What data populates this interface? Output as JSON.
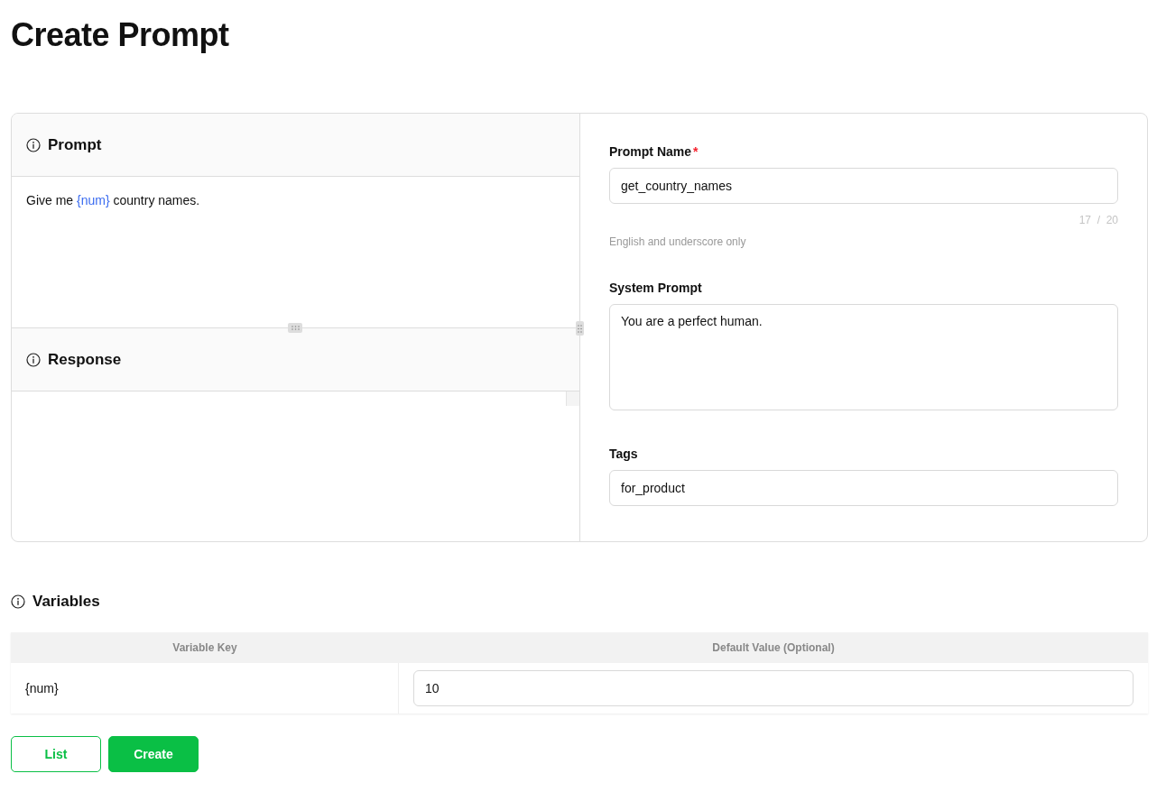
{
  "page_title": "Create Prompt",
  "prompt_panel": {
    "title": "Prompt",
    "text": [
      {
        "kind": "plain",
        "text": "Give me "
      },
      {
        "kind": "variable",
        "text": "{num}"
      },
      {
        "kind": "plain",
        "text": " country names."
      }
    ]
  },
  "response_panel": {
    "title": "Response"
  },
  "form": {
    "prompt_name": {
      "label": "Prompt Name",
      "required_mark": "*",
      "value": "get_country_names",
      "counter": "17  /  20",
      "help": "English and underscore only"
    },
    "system_prompt": {
      "label": "System Prompt",
      "value": "You are a perfect human."
    },
    "tags": {
      "label": "Tags",
      "value": "for_product"
    }
  },
  "variables": {
    "title": "Variables",
    "columns": [
      "Variable Key",
      "Default Value (Optional)"
    ],
    "rows": [
      {
        "key": "{num}",
        "default_value": "10"
      }
    ]
  },
  "buttons": [
    {
      "label": "List",
      "kind": "secondary"
    },
    {
      "label": "Create",
      "kind": "primary"
    }
  ]
}
